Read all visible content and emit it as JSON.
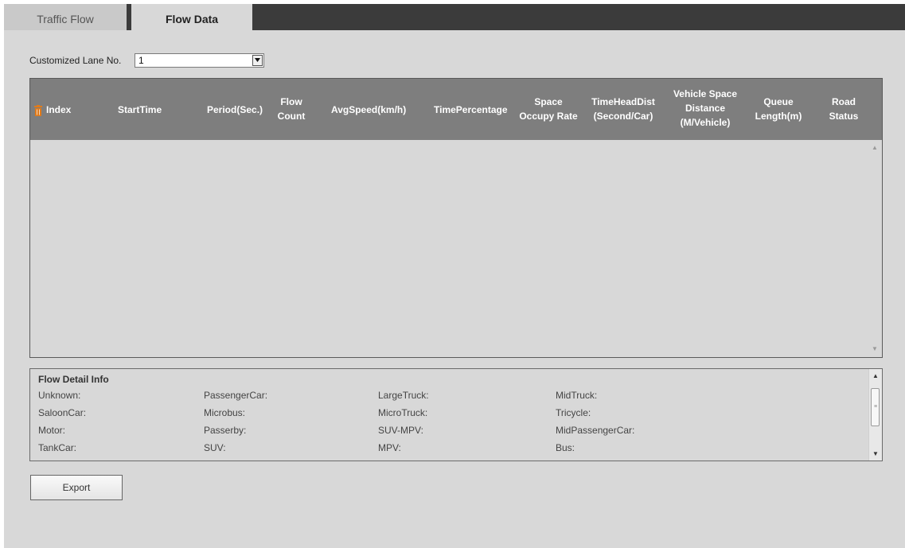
{
  "tabs": [
    {
      "label": "Traffic Flow",
      "active": false
    },
    {
      "label": "Flow Data",
      "active": true
    }
  ],
  "lane": {
    "label": "Customized Lane No.",
    "value": "1"
  },
  "columns": {
    "index": "Index",
    "start_time": "StartTime",
    "period": "Period(Sec.)",
    "flow_count": [
      "Flow",
      "Count"
    ],
    "avg_speed": "AvgSpeed(km/h)",
    "time_percentage": "TimePercentage",
    "space_occupy": [
      "Space",
      "Occupy Rate"
    ],
    "time_head": [
      "TimeHeadDist",
      "(Second/Car)"
    ],
    "vehicle_space": [
      "Vehicle Space",
      "Distance",
      "(M/Vehicle)"
    ],
    "queue": [
      "Queue",
      "Length(m)"
    ],
    "road_status": [
      "Road",
      "Status"
    ]
  },
  "rows": [],
  "detail": {
    "title": "Flow Detail Info",
    "labels": [
      [
        "Unknown:",
        "PassengerCar:",
        "LargeTruck:",
        "MidTruck:"
      ],
      [
        "SaloonCar:",
        "Microbus:",
        "MicroTruck:",
        "Tricycle:"
      ],
      [
        "Motor:",
        "Passerby:",
        "SUV-MPV:",
        "MidPassengerCar:"
      ],
      [
        "TankCar:",
        "SUV:",
        "MPV:",
        "Bus:"
      ]
    ]
  },
  "export_label": "Export",
  "icons": {
    "delete": "trash-icon",
    "dropdown": "chevron-down-icon"
  },
  "colors": {
    "header_bg": "#7e7e7e",
    "tabbar_bg": "#3b3b3b",
    "panel_bg": "#d8d8d8",
    "trash": "#e07a1a"
  }
}
